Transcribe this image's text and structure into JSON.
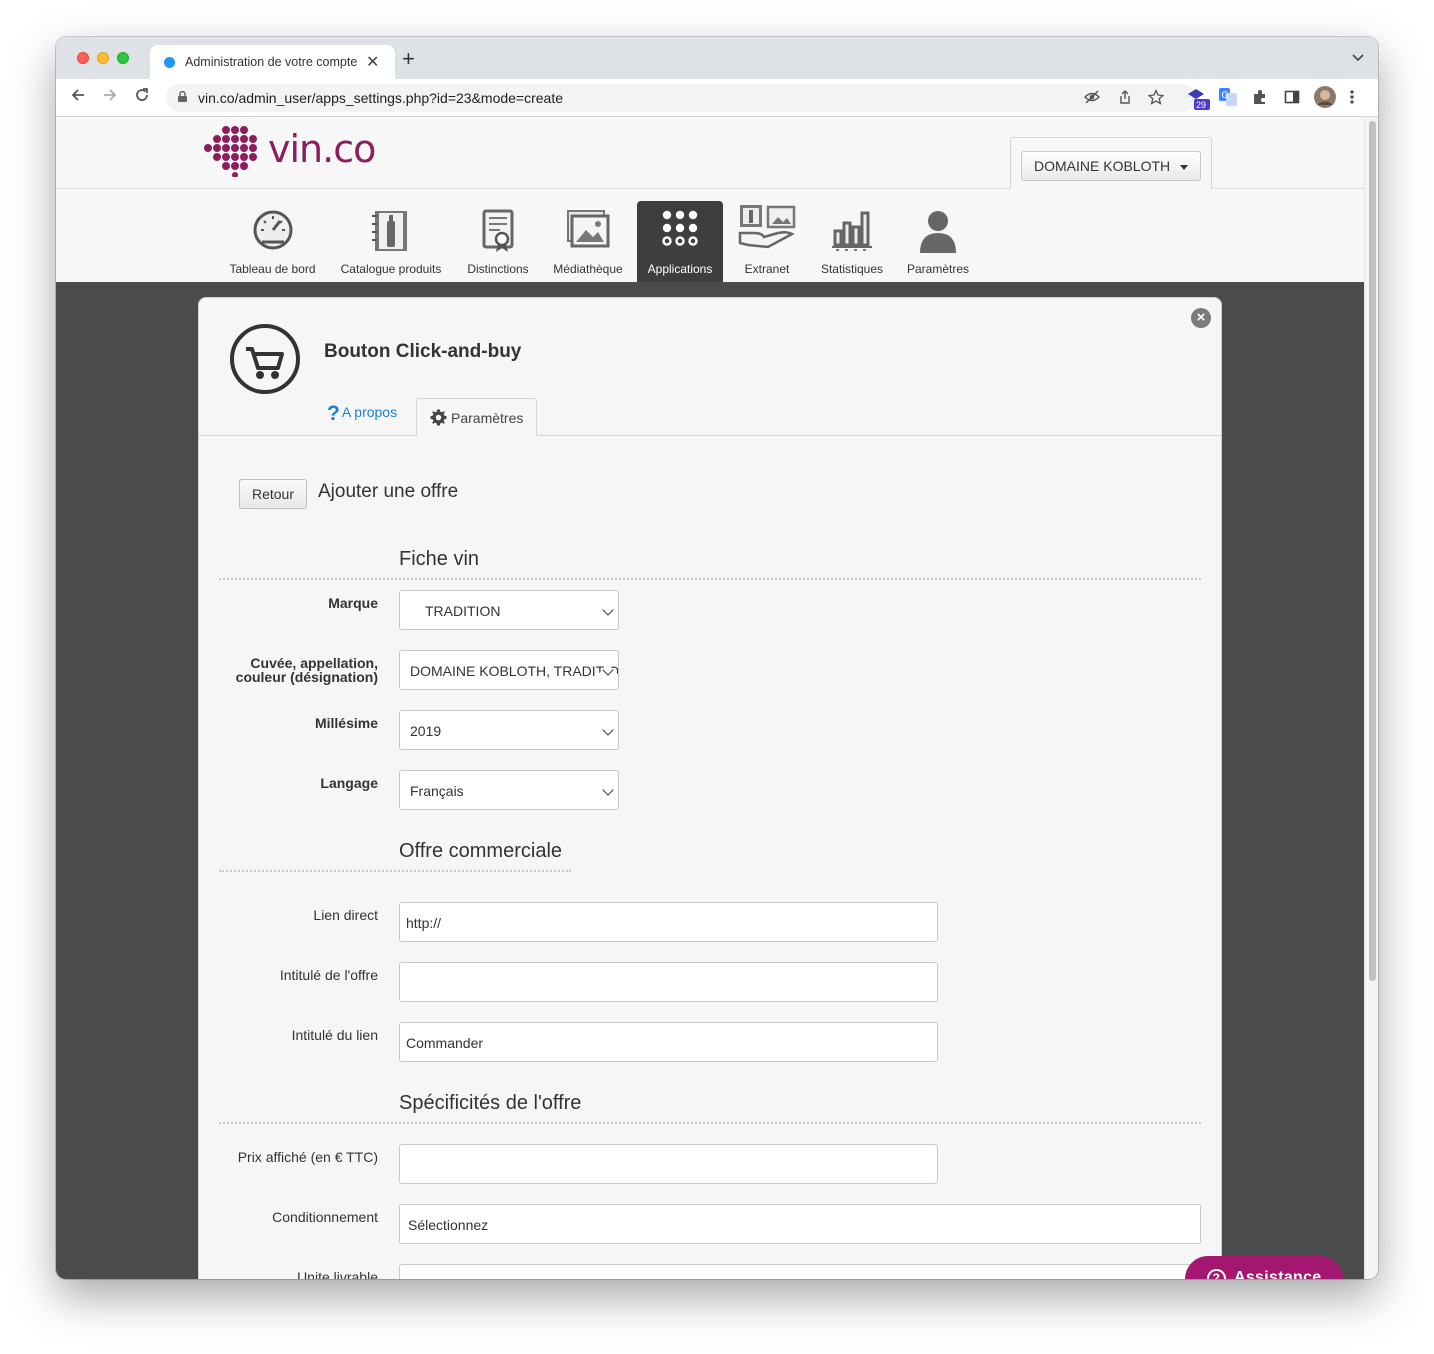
{
  "browser": {
    "tab_title": "Administration de votre compte",
    "url": "vin.co/admin_user/apps_settings.php?id=23&mode=create",
    "extension_badge": "29"
  },
  "site": {
    "logo_text": "vin.co",
    "account_label": "DOMAINE KOBLOTH",
    "nav": [
      {
        "label": "Tableau de bord",
        "icon": "dashboard-gauge-icon"
      },
      {
        "label": "Catalogue produits",
        "icon": "catalog-bottle-icon"
      },
      {
        "label": "Distinctions",
        "icon": "certificate-icon"
      },
      {
        "label": "Médiathèque",
        "icon": "picture-icon"
      },
      {
        "label": "Applications",
        "icon": "apps-grid-icon",
        "active": true
      },
      {
        "label": "Extranet",
        "icon": "hand-gallery-icon"
      },
      {
        "label": "Statistiques",
        "icon": "bar-chart-icon"
      },
      {
        "label": "Paramètres",
        "icon": "user-icon"
      }
    ]
  },
  "panel": {
    "title": "Bouton Click-and-buy",
    "tab_apropos": "A propos",
    "tab_params": "Paramètres",
    "back_button": "Retour",
    "heading": "Ajouter une offre"
  },
  "form": {
    "section_wine": "Fiche vin",
    "marque_label": "Marque",
    "marque_value": "TRADITION",
    "cuvee_label_1": "Cuvée, appellation,",
    "cuvee_label_2": "couleur (désignation)",
    "cuvee_value": "DOMAINE KOBLOTH, TRADITION",
    "millesime_label": "Millésime",
    "millesime_value": "2019",
    "langage_label": "Langage",
    "langage_value": "Français",
    "section_offer": "Offre commerciale",
    "lien_label": "Lien direct",
    "lien_value": "http://",
    "intitule_offre_label": "Intitulé de l'offre",
    "intitule_offre_value": "",
    "intitule_lien_label": "Intitulé du lien",
    "intitule_lien_value": "Commander",
    "section_specs": "Spécificités de l'offre",
    "prix_label": "Prix affiché (en € TTC)",
    "prix_value": "",
    "conditionnement_label": "Conditionnement",
    "conditionnement_value": "Sélectionnez",
    "unite_label": "Unite livrable"
  },
  "assistance": {
    "label": "Assistance"
  },
  "colors": {
    "brand": "#8c1d5e",
    "assist": "#a31770",
    "link": "#1a7fd4",
    "backdrop": "#4a4b4b"
  }
}
